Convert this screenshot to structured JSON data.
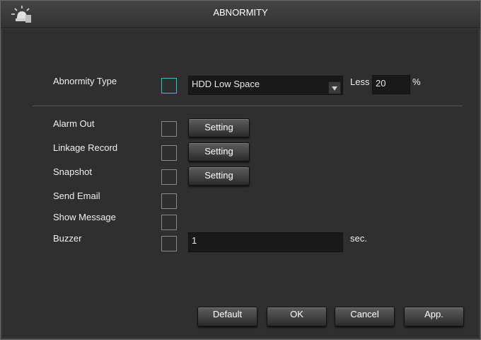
{
  "window": {
    "title": "ABNORMITY",
    "icon": "alarm-light-icon"
  },
  "abnormity": {
    "label": "Abnormity Type",
    "enabled": false,
    "type_value": "HDD Low Space",
    "less_label": "Less",
    "less_value": "20",
    "unit": "%"
  },
  "actions": [
    {
      "label": "Alarm Out",
      "checked": false,
      "button": "Setting"
    },
    {
      "label": "Linkage Record",
      "checked": false,
      "button": "Setting"
    },
    {
      "label": "Snapshot",
      "checked": false,
      "button": "Setting"
    },
    {
      "label": "Send Email",
      "checked": false
    },
    {
      "label": "Show Message",
      "checked": false
    },
    {
      "label": "Buzzer",
      "checked": false,
      "value": "1",
      "unit": "sec."
    }
  ],
  "footer": {
    "default": "Default",
    "ok": "OK",
    "cancel": "Cancel",
    "apply": "App."
  },
  "colors": {
    "focus": "#2ec3cf",
    "background": "#2f2f2f",
    "field": "#191919"
  }
}
